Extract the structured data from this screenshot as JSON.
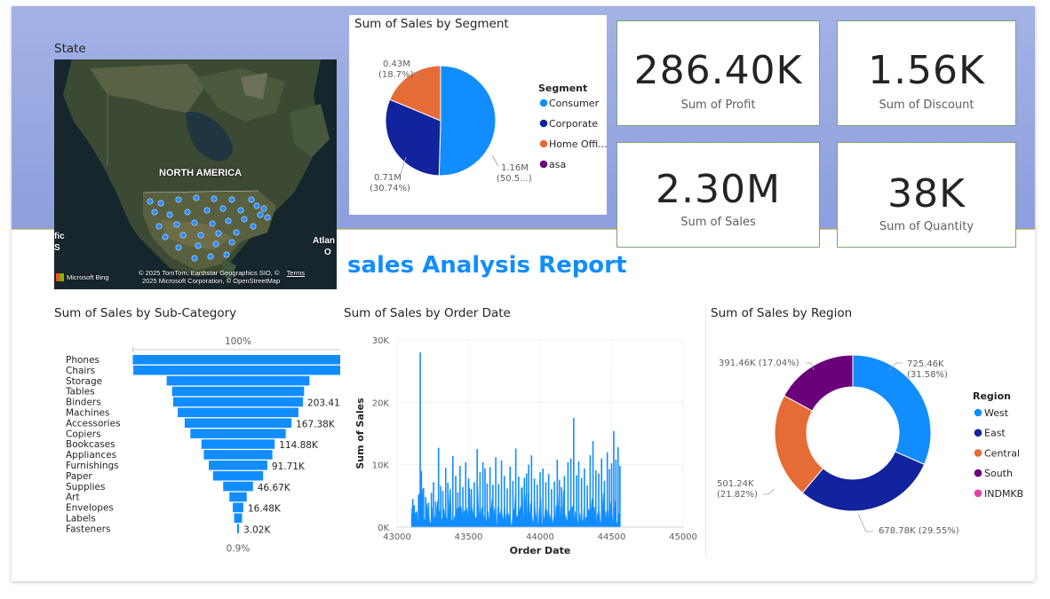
{
  "map": {
    "title": "State",
    "region_label": "NORTH AMERICA",
    "edge_left": "fic",
    "edge_left2": "S",
    "edge_right": "Atlan",
    "edge_right2": "O",
    "attribution_1": "© 2025 TomTom, Earthstar Geographics SIO, ©",
    "attribution_terms": "Terms",
    "attribution_2": "2025 Microsoft Corporation, © OpenStreetMap",
    "bing": "Microsoft Bing"
  },
  "segment_pie": {
    "title": "Sum of Sales by Segment",
    "legend_title": "Segment",
    "chart_data": {
      "type": "pie",
      "title": "Sum of Sales by Segment",
      "slices": [
        {
          "name": "Consumer",
          "value": 1.16,
          "pct": 50.5,
          "color": "#118dff",
          "label": "1.16M",
          "pct_label": "(50.5...)"
        },
        {
          "name": "Corporate",
          "value": 0.71,
          "pct": 30.74,
          "color": "#12239e",
          "label": "0.71M",
          "pct_label": "(30.74%)"
        },
        {
          "name": "Home Office",
          "value": 0.43,
          "pct": 18.7,
          "color": "#e66c37",
          "label": "0.43M",
          "pct_label": "(18.7%)"
        }
      ],
      "legend": [
        "Consumer",
        "Corporate",
        "Home Offi...",
        "asa"
      ],
      "legend_colors": [
        "#118dff",
        "#12239e",
        "#e66c37",
        "#6b007b"
      ]
    }
  },
  "cards": [
    {
      "value": "286.40K",
      "label": "Sum of Profit"
    },
    {
      "value": "1.56K",
      "label": "Sum of Discount"
    },
    {
      "value": "2.30M",
      "label": "Sum of Sales"
    },
    {
      "value": "38K",
      "label": "Sum of Quantity"
    }
  ],
  "report_title": "sales Analysis Report",
  "funnel": {
    "title": "Sum of Sales by Sub-Category",
    "top_pct": "100%",
    "bottom_pct": "0.9%",
    "chart_data": {
      "type": "bar",
      "title": "Sum of Sales by Sub-Category",
      "categories": [
        "Phones",
        "Chairs",
        "Storage",
        "Tables",
        "Binders",
        "Machines",
        "Accessories",
        "Copiers",
        "Bookcases",
        "Appliances",
        "Furnishings",
        "Paper",
        "Supplies",
        "Art",
        "Envelopes",
        "Labels",
        "Fasteners"
      ],
      "values": [
        330.0,
        328.4,
        223.8,
        206.97,
        203.41,
        189.24,
        167.38,
        149.53,
        114.88,
        107.53,
        91.71,
        78.48,
        46.67,
        27.12,
        16.48,
        12.49,
        3.02
      ],
      "data_labels": {
        "4": "203.41K",
        "6": "167.38K",
        "8": "114.88K",
        "10": "91.71K",
        "12": "46.67K",
        "14": "16.48K",
        "16": "3.02K"
      },
      "unit": "K"
    }
  },
  "line": {
    "title": "Sum of Sales by Order Date",
    "chart_data": {
      "type": "line",
      "title": "Sum of Sales by Order Date",
      "xlabel": "Order Date",
      "ylabel": "Sum of Sales",
      "xlim": [
        43000,
        45000
      ],
      "ylim": [
        0,
        30000
      ],
      "xticks": [
        43000,
        43500,
        44000,
        44500,
        45000
      ],
      "yticks": [
        0,
        10000,
        20000,
        30000
      ],
      "ytick_labels": [
        "0K",
        "10K",
        "20K",
        "30K"
      ],
      "x_range_data": [
        43100,
        44560
      ],
      "series": [
        {
          "values": [
            [
              43110,
              4500
            ],
            [
              43120,
              3500
            ],
            [
              43135,
              2500
            ],
            [
              43150,
              5200
            ],
            [
              43162,
              28000
            ],
            [
              43170,
              9000
            ],
            [
              43185,
              6300
            ],
            [
              43200,
              4800
            ],
            [
              43220,
              3900
            ],
            [
              43240,
              5500
            ],
            [
              43255,
              7200
            ],
            [
              43270,
              4100
            ],
            [
              43290,
              12700
            ],
            [
              43305,
              6600
            ],
            [
              43320,
              5800
            ],
            [
              43340,
              9500
            ],
            [
              43355,
              7100
            ],
            [
              43370,
              5200
            ],
            [
              43390,
              11400
            ],
            [
              43410,
              8200
            ],
            [
              43425,
              5600
            ],
            [
              43440,
              9800
            ],
            [
              43460,
              6400
            ],
            [
              43480,
              10400
            ],
            [
              43500,
              7800
            ],
            [
              43520,
              6100
            ],
            [
              43540,
              7200
            ],
            [
              43560,
              12500
            ],
            [
              43580,
              8800
            ],
            [
              43600,
              10400
            ],
            [
              43615,
              9400
            ],
            [
              43630,
              7000
            ],
            [
              43650,
              9600
            ],
            [
              43670,
              6800
            ],
            [
              43690,
              11200
            ],
            [
              43710,
              6900
            ],
            [
              43730,
              10700
            ],
            [
              43750,
              8200
            ],
            [
              43770,
              6200
            ],
            [
              43790,
              9700
            ],
            [
              43810,
              7400
            ],
            [
              43830,
              12600
            ],
            [
              43850,
              8100
            ],
            [
              43870,
              6300
            ],
            [
              43890,
              7900
            ],
            [
              43905,
              8600
            ],
            [
              43920,
              10000
            ],
            [
              43940,
              11500
            ],
            [
              43960,
              7800
            ],
            [
              43980,
              6800
            ],
            [
              44000,
              8800
            ],
            [
              44020,
              9400
            ],
            [
              44040,
              7200
            ],
            [
              44060,
              8500
            ],
            [
              44080,
              6100
            ],
            [
              44100,
              7300
            ],
            [
              44120,
              10800
            ],
            [
              44135,
              7600
            ],
            [
              44150,
              6400
            ],
            [
              44170,
              8200
            ],
            [
              44195,
              10400
            ],
            [
              44215,
              11000
            ],
            [
              44235,
              17500
            ],
            [
              44255,
              8300
            ],
            [
              44270,
              10500
            ],
            [
              44290,
              7900
            ],
            [
              44310,
              9400
            ],
            [
              44330,
              6700
            ],
            [
              44350,
              11500
            ],
            [
              44370,
              13800
            ],
            [
              44390,
              9100
            ],
            [
              44410,
              8600
            ],
            [
              44430,
              11000
            ],
            [
              44450,
              7400
            ],
            [
              44470,
              12000
            ],
            [
              44485,
              9300
            ],
            [
              44500,
              10200
            ],
            [
              44515,
              15400
            ],
            [
              44530,
              10800
            ],
            [
              44545,
              12800
            ],
            [
              44558,
              9800
            ]
          ]
        }
      ]
    }
  },
  "region_donut": {
    "title": "Sum of Sales by Region",
    "legend_title": "Region",
    "chart_data": {
      "type": "pie",
      "title": "Sum of Sales by Region",
      "slices": [
        {
          "name": "West",
          "value": 725.46,
          "pct": 31.58,
          "color": "#118dff",
          "label": "725.46K (31.58%)"
        },
        {
          "name": "East",
          "value": 678.78,
          "pct": 29.55,
          "color": "#12239e",
          "label": "678.78K (29.55%)"
        },
        {
          "name": "Central",
          "value": 501.24,
          "pct": 21.82,
          "color": "#e66c37",
          "label": "501.24K (21.82%)"
        },
        {
          "name": "South",
          "value": 391.46,
          "pct": 17.04,
          "color": "#6b007b",
          "label": "391.46K (17.04%)"
        }
      ],
      "legend": [
        "West",
        "East",
        "Central",
        "South",
        "INDMKB"
      ],
      "legend_colors": [
        "#118dff",
        "#12239e",
        "#e66c37",
        "#6b007b",
        "#e044a7"
      ]
    }
  }
}
